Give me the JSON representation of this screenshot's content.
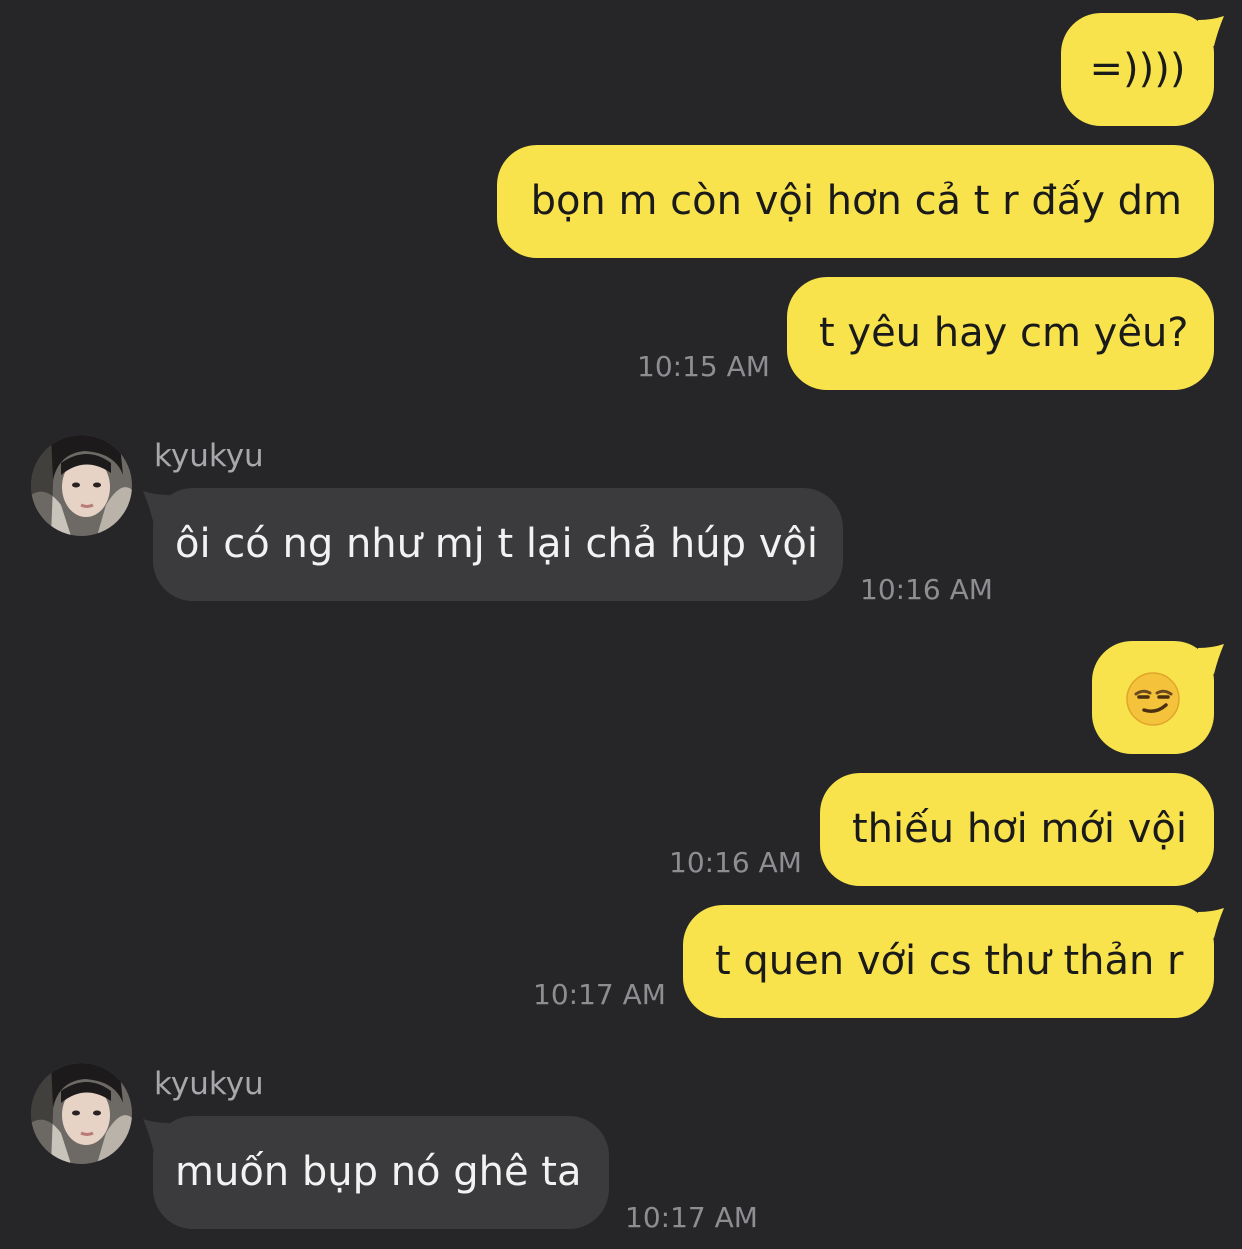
{
  "theme": {
    "background": "#262628",
    "outgoing_bubble": "#f8e34d",
    "incoming_bubble": "#3b3b3d",
    "timestamp_color": "#8e8e92"
  },
  "messages": [
    {
      "direction": "outgoing",
      "text": "=))))"
    },
    {
      "direction": "outgoing",
      "text": "bọn m còn vội hơn cả t r đấy dm"
    },
    {
      "direction": "outgoing",
      "text": "t yêu hay cm yêu?",
      "time": "10:15 AM"
    },
    {
      "direction": "incoming",
      "sender": "kyukyu",
      "text": "ôi có ng như mj t lại chả húp vội",
      "time": "10:16 AM"
    },
    {
      "direction": "outgoing",
      "text": "",
      "emoji_icon": "smirking-face-icon"
    },
    {
      "direction": "outgoing",
      "text": "thiếu hơi mới vội",
      "time": "10:16 AM"
    },
    {
      "direction": "outgoing",
      "text": "t quen với cs thư thản r",
      "time": "10:17 AM"
    },
    {
      "direction": "incoming",
      "sender": "kyukyu",
      "text": "muốn bụp nó ghê ta",
      "time": "10:17 AM"
    }
  ]
}
